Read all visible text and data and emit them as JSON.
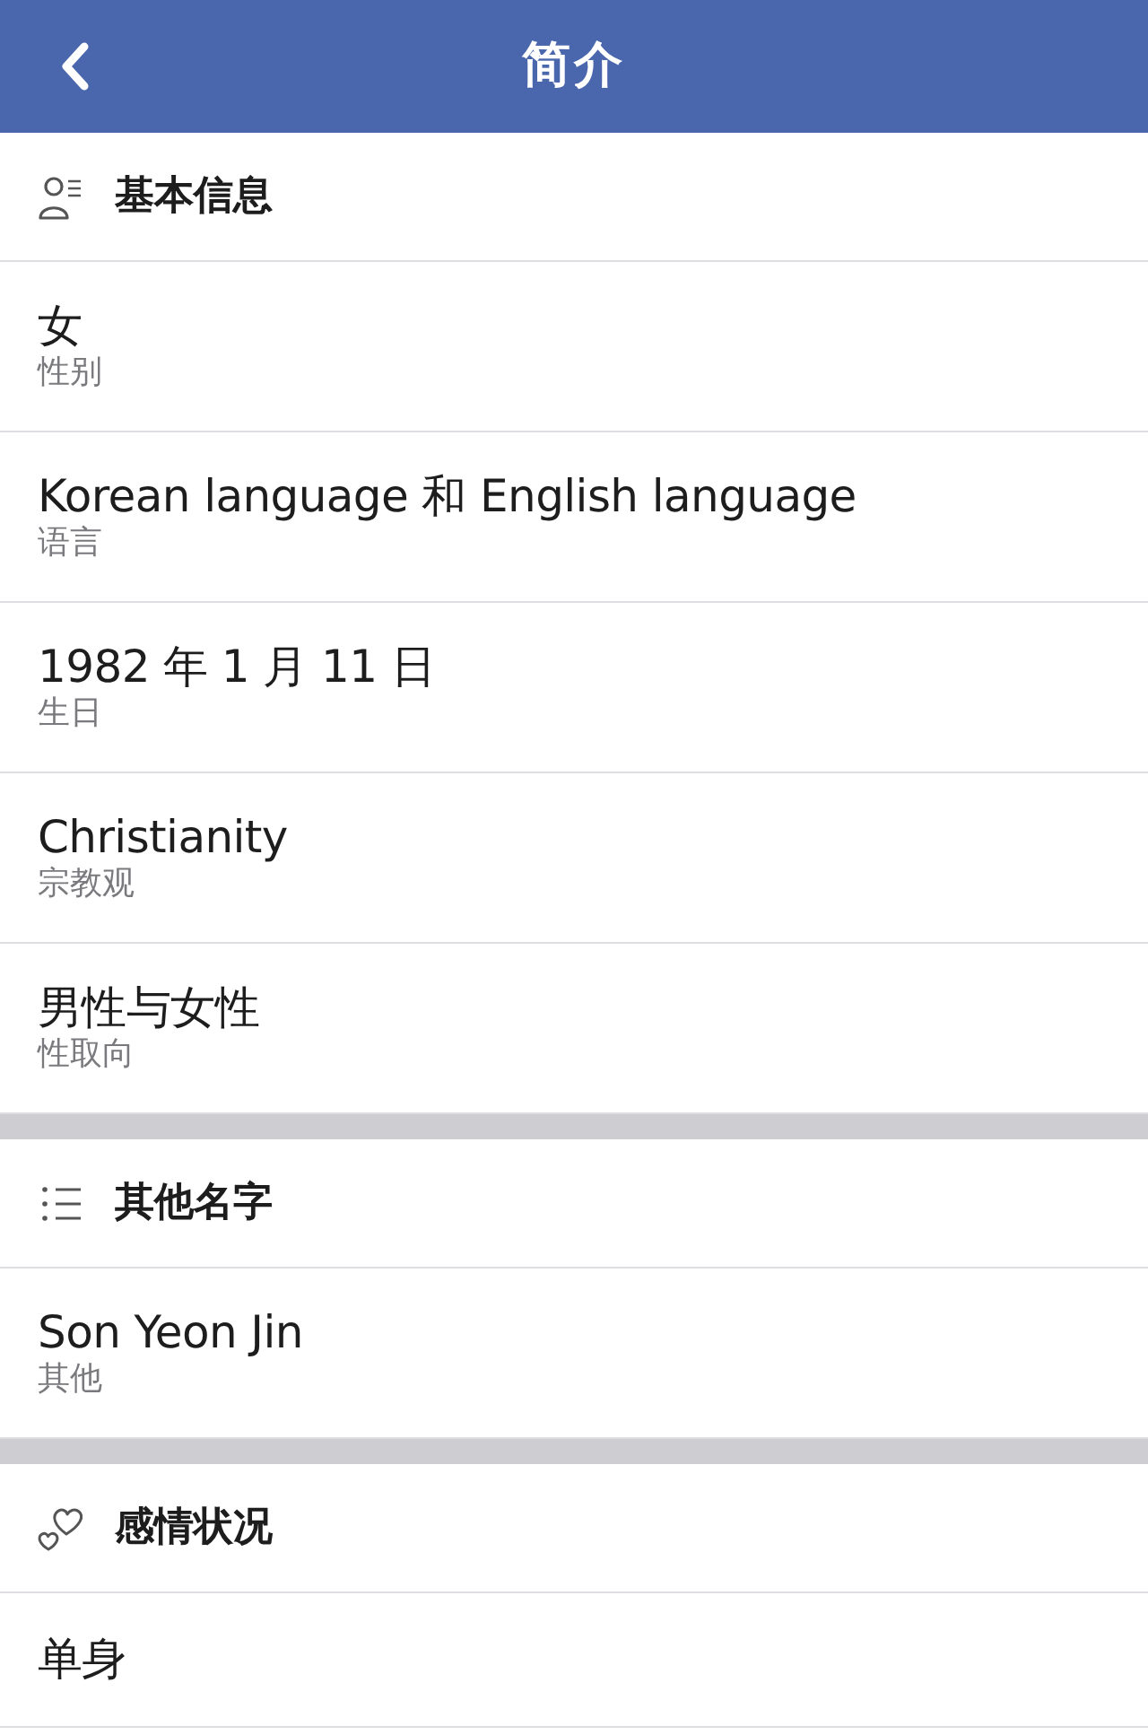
{
  "header": {
    "title": "简介"
  },
  "sections": [
    {
      "title": "基本信息",
      "rows": [
        {
          "value": "女",
          "label": "性别"
        },
        {
          "value": "Korean language 和 English language",
          "label": "语言"
        },
        {
          "value": "1982 年 1 月 11 日",
          "label": "生日"
        },
        {
          "value": "Christianity",
          "label": "宗教观"
        },
        {
          "value": "男性与女性",
          "label": "性取向"
        }
      ]
    },
    {
      "title": "其他名字",
      "rows": [
        {
          "value": "Son Yeon Jin",
          "label": "其他"
        }
      ]
    },
    {
      "title": "感情状况",
      "rows": [
        {
          "value": "单身"
        }
      ]
    }
  ]
}
